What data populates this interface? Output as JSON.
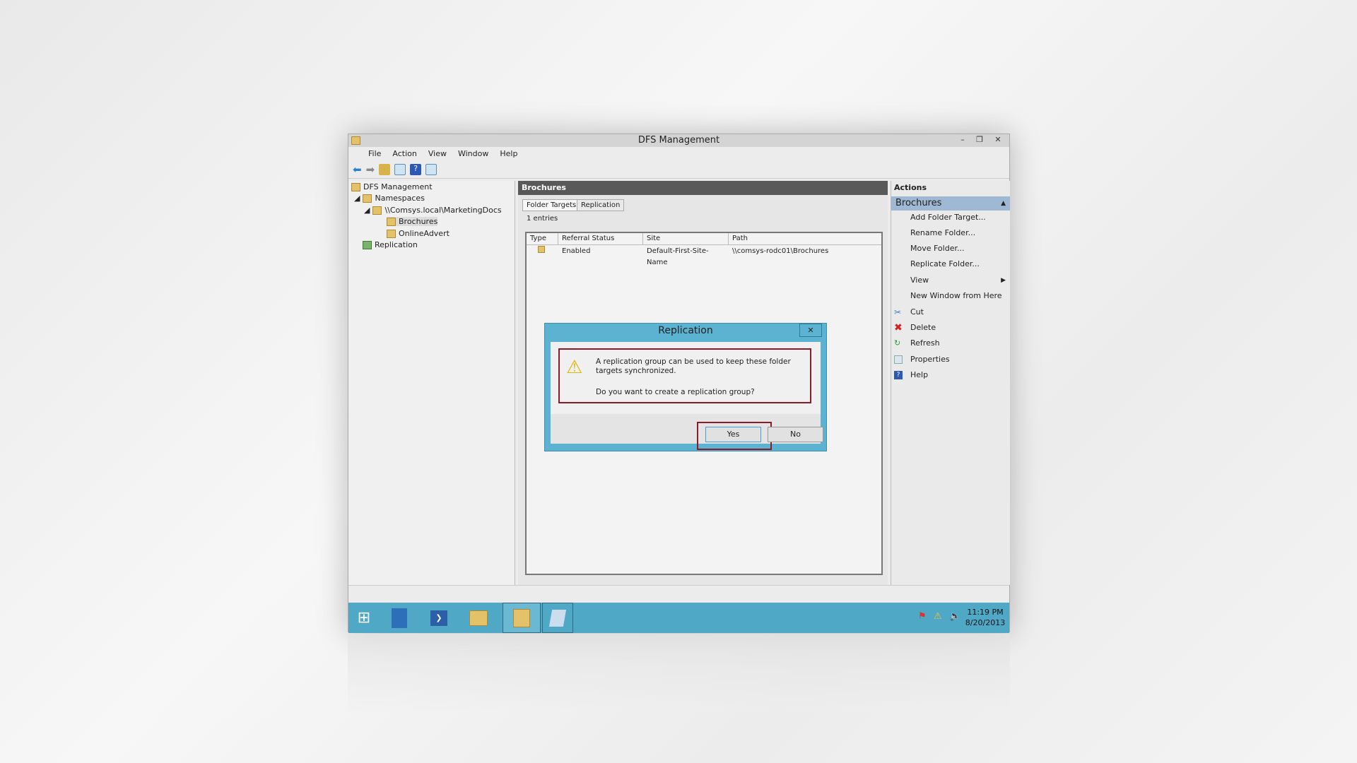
{
  "window": {
    "title": "DFS Management",
    "controls": [
      "–",
      "❐",
      "✕"
    ]
  },
  "menu": [
    "File",
    "Action",
    "View",
    "Window",
    "Help"
  ],
  "tree": {
    "root": "DFS Management",
    "namespaces": "Namespaces",
    "namespace": "\\\\Comsys.local\\MarketingDocs",
    "folders": [
      "Brochures",
      "OnlineAdvert"
    ],
    "replication": "Replication"
  },
  "main": {
    "header": "Brochures",
    "tabs": [
      "Folder Targets",
      "Replication"
    ],
    "entries": "1 entries",
    "columns": [
      "Type",
      "Referral Status",
      "Site",
      "Path"
    ],
    "rows": [
      {
        "referral_status": "Enabled",
        "site": "Default-First-Site-Name",
        "path": "\\\\comsys-rodc01\\Brochures"
      }
    ]
  },
  "actions": {
    "title": "Actions",
    "section": "Brochures",
    "items": [
      "Add Folder Target...",
      "Rename Folder...",
      "Move Folder...",
      "Replicate Folder...",
      "View",
      "New Window from Here",
      "Cut",
      "Delete",
      "Refresh",
      "Properties",
      "Help"
    ]
  },
  "dialog": {
    "title": "Replication",
    "close": "✕",
    "message": "A replication group can be used to keep these folder targets synchronized.",
    "question": "Do you want to create a replication group?",
    "yes": "Yes",
    "no": "No",
    "highlight_color": "#8b1a2b"
  },
  "taskbar": {
    "time": "11:19 PM",
    "date": "8/20/2013"
  }
}
